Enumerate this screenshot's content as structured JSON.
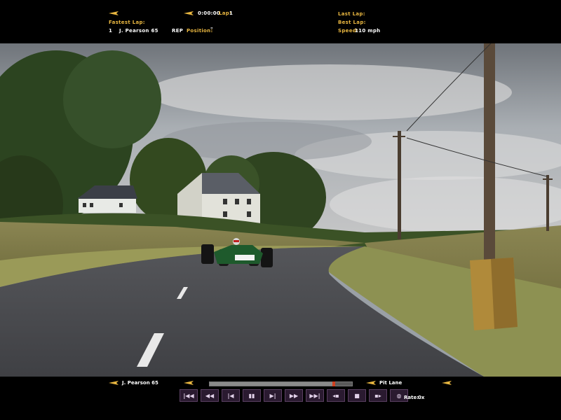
{
  "hud": {
    "time_value": "0:00:00",
    "lap_label": "Lap:",
    "lap_value": "1",
    "fastest_lap_label": "Fastest Lap:",
    "fastest_rank": "1",
    "fastest_driver": "J. Pearson 65",
    "rep_label": "REP",
    "position_label": "Position:",
    "position_value": "\"",
    "last_lap_label": "Last Lap:",
    "best_lap_label": "Best Lap:",
    "speed_label": "Speed:",
    "speed_value": "110 mph"
  },
  "bottom": {
    "driver": "J. Pearson 65",
    "camera": "Pit Lane",
    "rate_label": "Rate:",
    "rate_value": "0x",
    "replay_progress": 0.87,
    "controls": [
      {
        "name": "skip-start",
        "glyph": "|◀◀"
      },
      {
        "name": "rewind",
        "glyph": "◀◀"
      },
      {
        "name": "step-back",
        "glyph": "|◀"
      },
      {
        "name": "pause",
        "glyph": "▮▮"
      },
      {
        "name": "step-forward",
        "glyph": "▶|"
      },
      {
        "name": "fast-forward",
        "glyph": "▶▶"
      },
      {
        "name": "skip-end",
        "glyph": "▶▶|"
      },
      {
        "name": "camera-prev",
        "glyph": "◂▪"
      },
      {
        "name": "stop",
        "glyph": "■"
      },
      {
        "name": "camera-next",
        "glyph": "▪▸"
      },
      {
        "name": "record",
        "glyph": "◍"
      }
    ]
  },
  "colors": {
    "hud_accent": "#e8b640",
    "hud_text": "#ffffff",
    "car_green": "#1e5a2c"
  }
}
